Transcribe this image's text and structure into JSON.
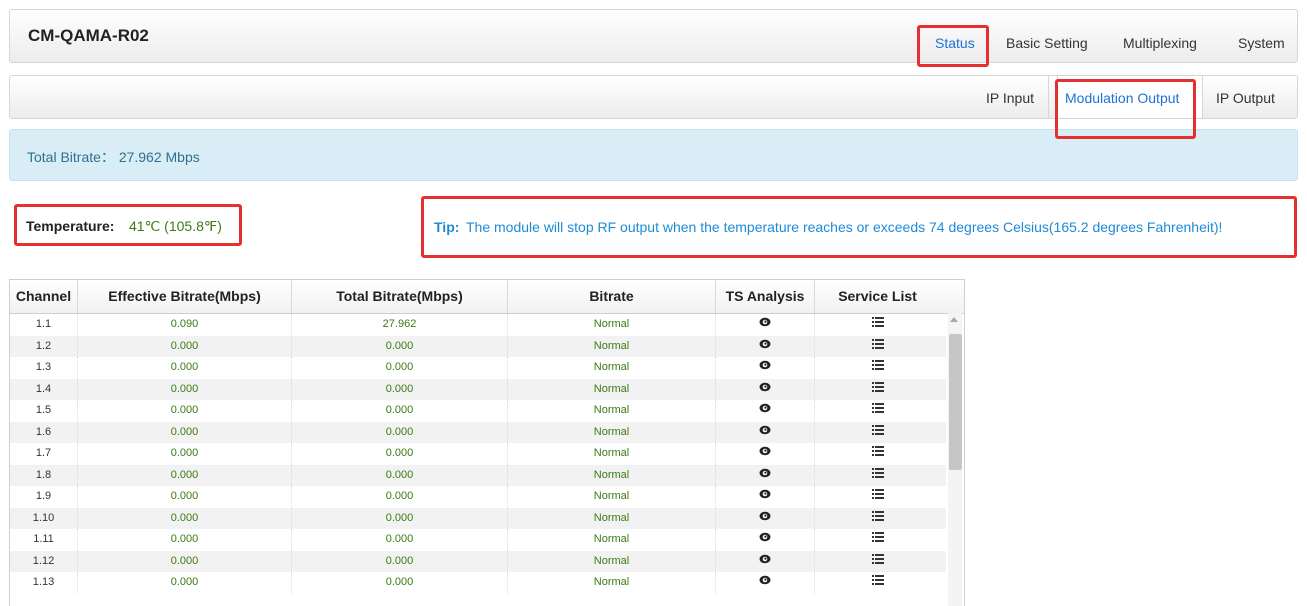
{
  "app": {
    "title": "CM-QAMA-R02"
  },
  "nav": [
    {
      "label": "Status",
      "active": true
    },
    {
      "label": "Basic Setting",
      "active": false
    },
    {
      "label": "Multiplexing",
      "active": false
    },
    {
      "label": "System",
      "active": false
    }
  ],
  "subnav": [
    {
      "label": "IP Input",
      "active": false
    },
    {
      "label": "Modulation Output",
      "active": true
    },
    {
      "label": "IP Output",
      "active": false
    }
  ],
  "alert": {
    "text": "Total Bitrate： 27.962 Mbps"
  },
  "temperature": {
    "label": "Temperature:",
    "value": "41℃ (105.8℉)"
  },
  "tip": {
    "label": "Tip:",
    "text": "The module will stop RF output when the temperature reaches or exceeds 74 degrees Celsius(165.2 degrees Fahrenheit)!"
  },
  "table": {
    "columns": [
      "Channel",
      "Effective Bitrate(Mbps)",
      "Total Bitrate(Mbps)",
      "Bitrate",
      "TS Analysis",
      "Service List"
    ],
    "rows": [
      {
        "channel": "1.1",
        "effective": "0.090",
        "total": "27.962",
        "bitrate": "Normal"
      },
      {
        "channel": "1.2",
        "effective": "0.000",
        "total": "0.000",
        "bitrate": "Normal"
      },
      {
        "channel": "1.3",
        "effective": "0.000",
        "total": "0.000",
        "bitrate": "Normal"
      },
      {
        "channel": "1.4",
        "effective": "0.000",
        "total": "0.000",
        "bitrate": "Normal"
      },
      {
        "channel": "1.5",
        "effective": "0.000",
        "total": "0.000",
        "bitrate": "Normal"
      },
      {
        "channel": "1.6",
        "effective": "0.000",
        "total": "0.000",
        "bitrate": "Normal"
      },
      {
        "channel": "1.7",
        "effective": "0.000",
        "total": "0.000",
        "bitrate": "Normal"
      },
      {
        "channel": "1.8",
        "effective": "0.000",
        "total": "0.000",
        "bitrate": "Normal"
      },
      {
        "channel": "1.9",
        "effective": "0.000",
        "total": "0.000",
        "bitrate": "Normal"
      },
      {
        "channel": "1.10",
        "effective": "0.000",
        "total": "0.000",
        "bitrate": "Normal"
      },
      {
        "channel": "1.11",
        "effective": "0.000",
        "total": "0.000",
        "bitrate": "Normal"
      },
      {
        "channel": "1.12",
        "effective": "0.000",
        "total": "0.000",
        "bitrate": "Normal"
      },
      {
        "channel": "1.13",
        "effective": "0.000",
        "total": "0.000",
        "bitrate": "Normal"
      }
    ],
    "ts_icon": "eye-icon",
    "service_icon": "list-icon"
  },
  "colors": {
    "accent": "#1e72d6",
    "highlight": "#e53030",
    "value_green": "#3c7a12",
    "alert_bg": "#d9edf7"
  }
}
